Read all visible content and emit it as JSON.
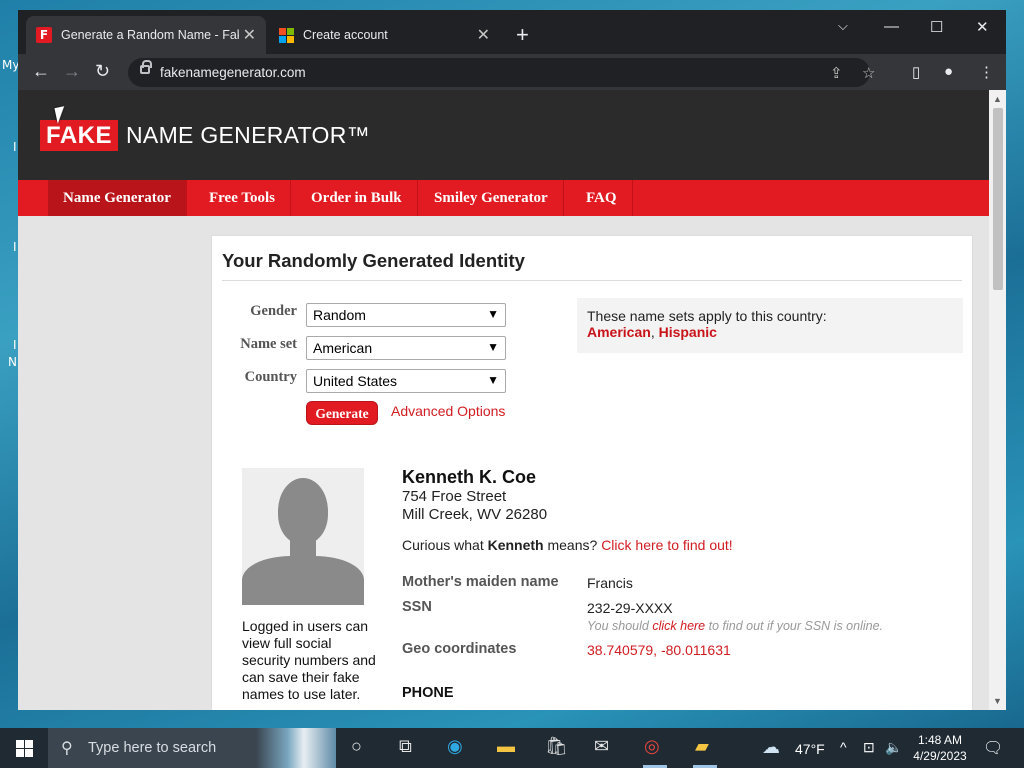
{
  "desktop": {
    "fragments": [
      "My",
      "I",
      "I",
      "I",
      "N"
    ]
  },
  "browser": {
    "tabs": [
      {
        "title": "Generate a Random Name - Fake Name Generator",
        "active": true
      },
      {
        "title": "Create account",
        "active": false
      }
    ],
    "url": "fakenamegenerator.com"
  },
  "site": {
    "logo_fake": "FAKE",
    "logo_rest": "NAME GENERATOR™",
    "nav": [
      "Name Generator",
      "Free Tools",
      "Order in Bulk",
      "Smiley Generator",
      "FAQ"
    ],
    "heading": "Your Randomly Generated Identity",
    "form": {
      "gender_label": "Gender",
      "gender_value": "Random",
      "nameset_label": "Name set",
      "nameset_value": "American",
      "country_label": "Country",
      "country_value": "United States",
      "generate_label": "Generate",
      "advanced_label": "Advanced Options"
    },
    "info": {
      "text": "These name sets apply to this country:",
      "set1": "American",
      "sep": ",",
      "set2": "Hispanic"
    },
    "identity": {
      "name": "Kenneth K. Coe",
      "address_line1": "754 Froe Street",
      "address_line2": "Mill Creek, WV 26280",
      "curious_prefix": "Curious what",
      "curious_name": "Kenneth",
      "curious_mid": "means?",
      "curious_link": "Click here to find out!",
      "maiden_label": "Mother's maiden name",
      "maiden_value": "Francis",
      "ssn_label": "SSN",
      "ssn_value": "232-29-XXXX",
      "ssn_note_prefix": "You should",
      "ssn_note_link": "click here",
      "ssn_note_suffix": "to find out if your SSN is online.",
      "geo_label": "Geo coordinates",
      "geo_value": "38.740579, -80.011631",
      "phone_header": "PHONE",
      "logged_note": "Logged in users can view full social security numbers and can save their fake names to use later."
    }
  },
  "taskbar": {
    "search_placeholder": "Type here to search",
    "weather": "47°F",
    "time": "1:48 AM",
    "date": "4/29/2023"
  },
  "colors": {
    "brand_red": "#e21a22",
    "header_dark": "#2b2b2b",
    "link_red": "#d11c22"
  }
}
